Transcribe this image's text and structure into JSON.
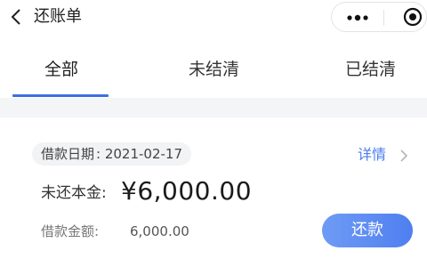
{
  "header": {
    "title": "还账单",
    "icons": {
      "back": "chevron-left-icon",
      "more": "more-dots-icon",
      "close": "target-circle-icon"
    }
  },
  "tabs": [
    {
      "label": "全部",
      "active": true
    },
    {
      "label": "未结清",
      "active": false
    },
    {
      "label": "已结清",
      "active": false
    }
  ],
  "accent_color": "#3d6fe3",
  "bill": {
    "date_label": "借款日期",
    "date_value": "2021-02-17",
    "detail_label": "详情",
    "principal_label": "未还本金:",
    "principal_value": "¥6,000.00",
    "loan_label": "借款金额:",
    "loan_value": "6,000.00",
    "repay_button": "还款"
  }
}
